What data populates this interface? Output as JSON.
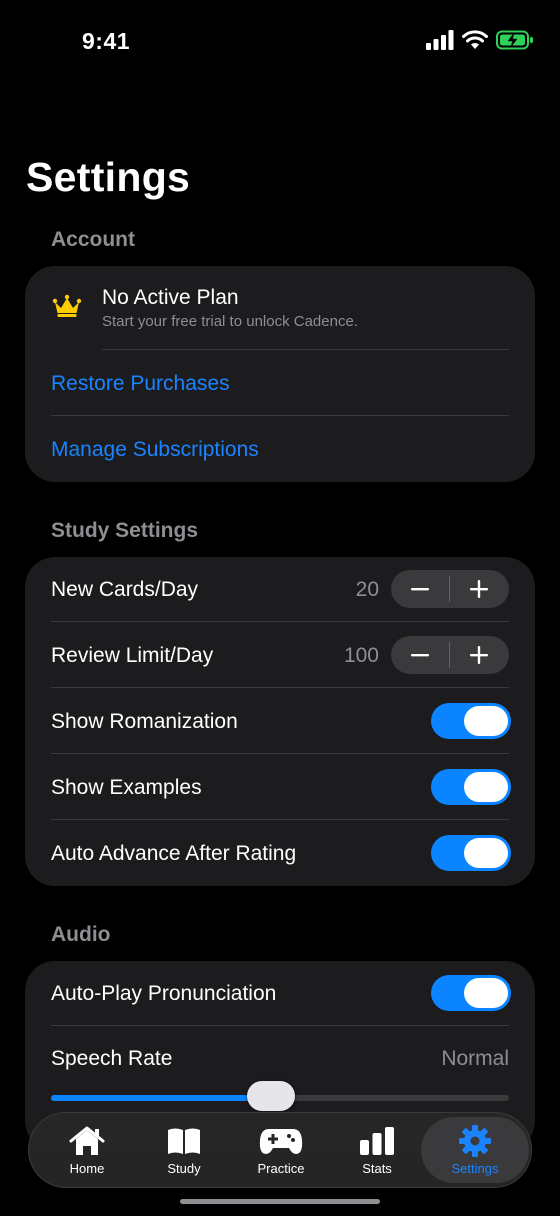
{
  "status_bar": {
    "time": "9:41"
  },
  "page": {
    "title": "Settings"
  },
  "account": {
    "header": "Account",
    "plan_title": "No Active Plan",
    "plan_subtitle": "Start your free trial to unlock Cadence.",
    "restore_label": "Restore Purchases",
    "manage_label": "Manage Subscriptions"
  },
  "study": {
    "header": "Study Settings",
    "new_cards": {
      "label": "New Cards/Day",
      "value": "20"
    },
    "review_limit": {
      "label": "Review Limit/Day",
      "value": "100"
    },
    "show_romanization": {
      "label": "Show Romanization",
      "on": true
    },
    "show_examples": {
      "label": "Show Examples",
      "on": true
    },
    "auto_advance": {
      "label": "Auto Advance After Rating",
      "on": true
    }
  },
  "audio": {
    "header": "Audio",
    "auto_play": {
      "label": "Auto-Play Pronunciation",
      "on": true
    },
    "speech_rate": {
      "label": "Speech Rate",
      "value": "Normal",
      "level": 0.48
    }
  },
  "tabbar": {
    "tabs": [
      {
        "label": "Home",
        "icon": "house-icon"
      },
      {
        "label": "Study",
        "icon": "book-icon"
      },
      {
        "label": "Practice",
        "icon": "gamecontroller-icon"
      },
      {
        "label": "Stats",
        "icon": "bar-chart-icon"
      },
      {
        "label": "Settings",
        "icon": "gear-icon",
        "active": true
      }
    ]
  },
  "colors": {
    "accent": "#0a84ff",
    "card": "#1c1c1e",
    "crown": "#ffcc00"
  }
}
